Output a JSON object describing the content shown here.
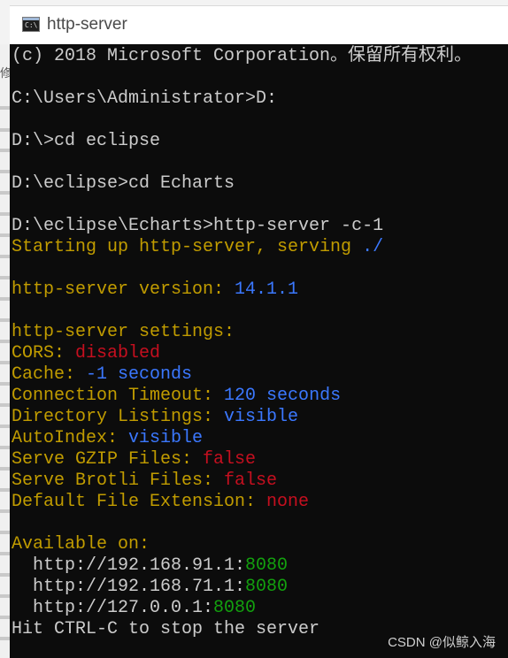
{
  "window": {
    "title": "http-server",
    "icon": "console-app-icon"
  },
  "left_strip_glyph": "修",
  "lines": {
    "copyright": "(c) 2018 Microsoft Corporation。保留所有权利。",
    "cmd1": "C:\\Users\\Administrator>D:",
    "cmd2": "D:\\>cd eclipse",
    "cmd3": "D:\\eclipse>cd Echarts",
    "cmd4": "D:\\eclipse\\Echarts>http-server -c-1",
    "starting": "Starting up http-server, serving ",
    "starting_path": "./",
    "version_label": "http-server version: ",
    "version_value": "14.1.1",
    "settings_header": "http-server settings:",
    "cors_label": "CORS: ",
    "cors_value": "disabled",
    "cache_label": "Cache: ",
    "cache_value": "-1 seconds",
    "timeout_label": "Connection Timeout: ",
    "timeout_value": "120 seconds",
    "dirlist_label": "Directory Listings: ",
    "dirlist_value": "visible",
    "autoindex_label": "AutoIndex: ",
    "autoindex_value": "visible",
    "gzip_label": "Serve GZIP Files: ",
    "gzip_value": "false",
    "brotli_label": "Serve Brotli Files: ",
    "brotli_value": "false",
    "ext_label": "Default File Extension: ",
    "ext_value": "none",
    "available": "Available on:",
    "addr1_host": "  http://192.168.91.1:",
    "addr1_port": "8080",
    "addr2_host": "  http://192.168.71.1:",
    "addr2_port": "8080",
    "addr3_host": "  http://127.0.0.1:",
    "addr3_port": "8080",
    "stop": "Hit CTRL-C to stop the server"
  },
  "watermark": "CSDN @似鲸入海",
  "colors": {
    "background": "#0c0c0c",
    "text": "#cccccc",
    "yellow": "#c19c00",
    "red": "#c50f1f",
    "blue": "#3b78ff",
    "green": "#13a10e"
  }
}
